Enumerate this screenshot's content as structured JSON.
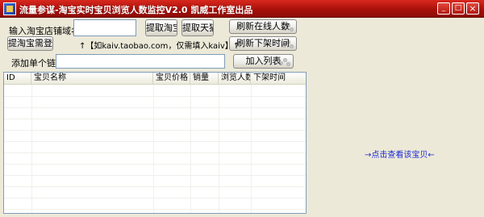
{
  "window": {
    "title": "流量参谋-淘宝实时宝贝浏览人数监控V2.0   凯威工作室出品",
    "minimize_glyph": "_",
    "maximize_glyph": "□",
    "close_glyph": "×"
  },
  "shop": {
    "label": "输入淘宝店铺域名:",
    "value": "",
    "hint": "↑【如kaiv.taobao.com，仅需填入kaiv】↑"
  },
  "buttons": {
    "fetch_taobao": "提取淘宝",
    "fetch_tmall": "提取天猫",
    "refresh_online": "刷新在线人数",
    "refresh_offtime": "刷新下架时间",
    "taobao_login": "提淘宝需登陆",
    "add_list": "加入列表"
  },
  "single_link": {
    "label": "添加单个链接:",
    "value": ""
  },
  "table": {
    "columns": [
      "ID",
      "宝贝名称",
      "宝贝价格",
      "销量",
      "浏览人数",
      "下架时间"
    ],
    "rows": []
  },
  "detail_link": "→点击查看该宝贝←"
}
